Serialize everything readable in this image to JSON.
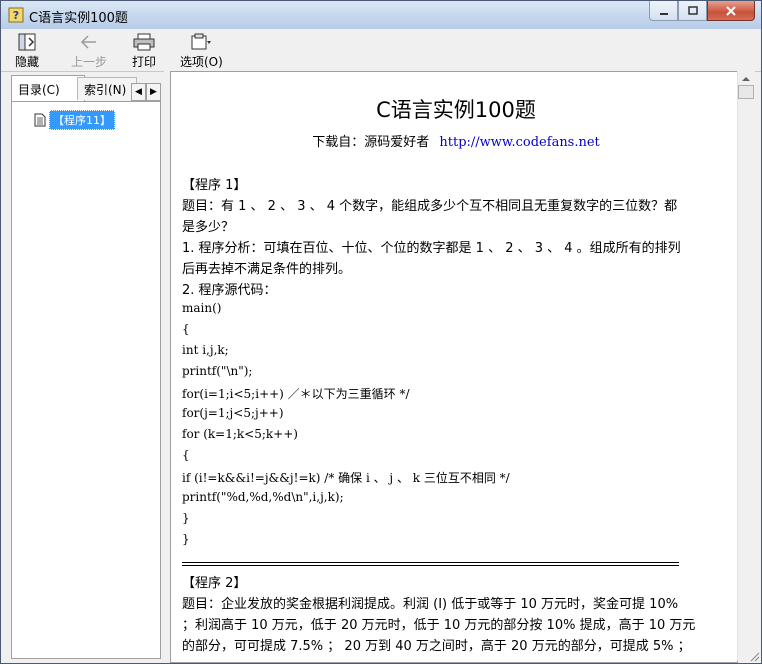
{
  "window": {
    "title": "C语言实例100题"
  },
  "toolbar": {
    "hide_label": "隐藏",
    "back_label": "上一步",
    "print_label": "打印",
    "options_label": "选项(O)"
  },
  "left_pane": {
    "tab_contents": "目录(C)",
    "tab_index": "索引(N)",
    "tree_items": [
      {
        "label": "【程序11】"
      }
    ]
  },
  "document": {
    "title": "C语言实例100题",
    "download_label": "下载自：源码爱好者",
    "url": "http://www.codefans.net",
    "lines": [
      "【程序 1】",
      "题目：有 1 、 2 、 3 、 4 个数字，能组成多少个互不相同且无重复数字的三位数？都",
      "是多少？",
      "1. 程序分析：可填在百位、十位、个位的数字都是 1 、 2 、 3 、 4 。组成所有的排列",
      "后再去掉不满足条件的排列。",
      "2. 程序源代码：",
      "main()",
      "{",
      "int i,j,k;",
      "printf(\"\\n\");",
      "for(i=1;i<5;i++)                ／＊以下为三重循环 */",
      "for(j=1;j<5;j++)",
      "for (k=1;k<5;k++)",
      "{",
      "if (i!=k&&i!=j&&j!=k) /* 确保 i 、 j 、 k 三位互不相同 */",
      "printf(\"%d,%d,%d\\n\",i,j,k);",
      "}",
      "}",
      "【程序 2】",
      "题目：企业发放的奖金根据利润提成。利润 (I) 低于或等于 10 万元时，奖金可提 10%",
      "；利润高于 10 万元，低于 20 万元时，低于 10 万元的部分按 10% 提成，高于 10 万元",
      "的部分，可可提成 7.5% ； 20 万到 40 万之间时，高于 20 万元的部分，可提成 5% ；"
    ]
  }
}
